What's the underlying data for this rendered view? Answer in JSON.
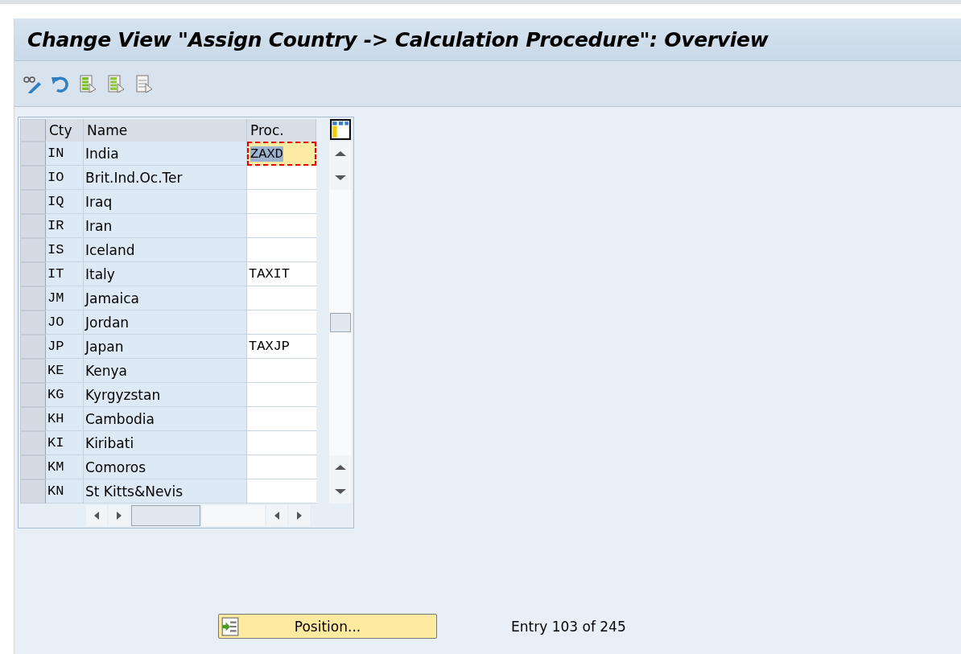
{
  "window": {
    "title": "Change View \"Assign Country -> Calculation Procedure\": Overview"
  },
  "table": {
    "columns": [
      "Cty",
      "Name",
      "Proc."
    ],
    "rows": [
      {
        "cty": "IN",
        "name": "India",
        "proc": "ZAXD",
        "focused": true
      },
      {
        "cty": "IO",
        "name": "Brit.Ind.Oc.Ter",
        "proc": "",
        "focused": false
      },
      {
        "cty": "IQ",
        "name": "Iraq",
        "proc": "",
        "focused": false
      },
      {
        "cty": "IR",
        "name": "Iran",
        "proc": "",
        "focused": false
      },
      {
        "cty": "IS",
        "name": "Iceland",
        "proc": "",
        "focused": false
      },
      {
        "cty": "IT",
        "name": "Italy",
        "proc": "TAXIT",
        "focused": false
      },
      {
        "cty": "JM",
        "name": "Jamaica",
        "proc": "",
        "focused": false
      },
      {
        "cty": "JO",
        "name": "Jordan",
        "proc": "",
        "focused": false
      },
      {
        "cty": "JP",
        "name": "Japan",
        "proc": "TAXJP",
        "focused": false
      },
      {
        "cty": "KE",
        "name": "Kenya",
        "proc": "",
        "focused": false
      },
      {
        "cty": "KG",
        "name": "Kyrgyzstan",
        "proc": "",
        "focused": false
      },
      {
        "cty": "KH",
        "name": "Cambodia",
        "proc": "",
        "focused": false
      },
      {
        "cty": "KI",
        "name": "Kiribati",
        "proc": "",
        "focused": false
      },
      {
        "cty": "KM",
        "name": "Comoros",
        "proc": "",
        "focused": false
      },
      {
        "cty": "KN",
        "name": "St Kitts&Nevis",
        "proc": "",
        "focused": false
      }
    ]
  },
  "footer": {
    "button": "Position...",
    "entry": "Entry 103 of 245"
  }
}
